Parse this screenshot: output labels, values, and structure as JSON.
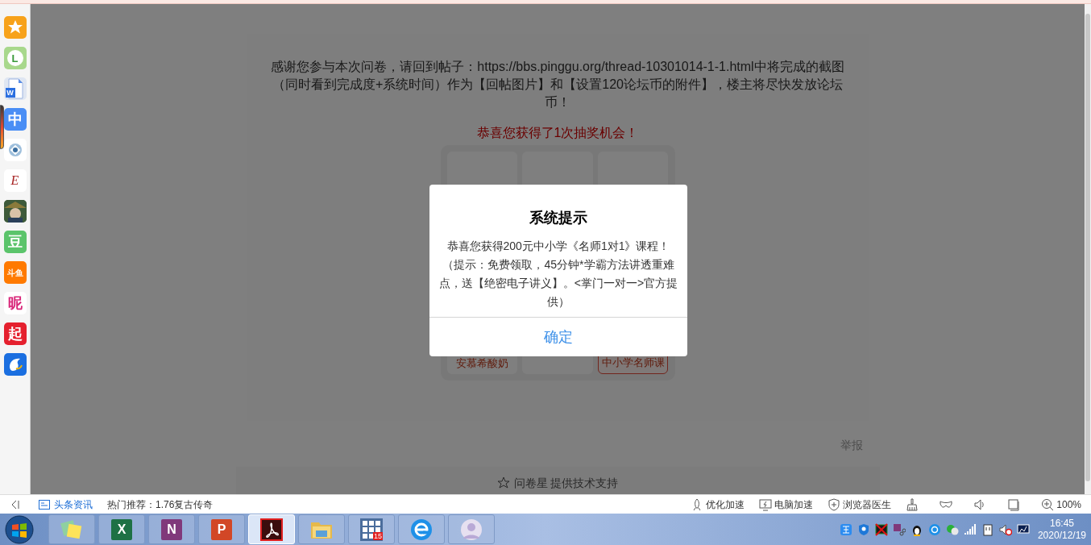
{
  "sidebar": {
    "apps": [
      {
        "kind": "star",
        "color": "#f7a21b"
      },
      {
        "kind": "clock",
        "color": "#a8d88c",
        "glyph": "L"
      },
      {
        "kind": "document",
        "color": "#dfe6f2",
        "glyph": "W"
      },
      {
        "kind": "text",
        "color": "#4a8ef5",
        "glyph": "中"
      },
      {
        "kind": "target",
        "color": "#ffffff"
      },
      {
        "kind": "serif",
        "color": "#ffffff",
        "glyph": "E"
      },
      {
        "kind": "picture",
        "color": "#3d5a3a"
      },
      {
        "kind": "text",
        "color": "#5bc46b",
        "glyph": "豆"
      },
      {
        "kind": "text",
        "color": "#ff7a00",
        "glyph": "斗鱼"
      },
      {
        "kind": "pinktext",
        "color": "#ffffff",
        "glyph": "昵"
      },
      {
        "kind": "text",
        "color": "#e5202e",
        "glyph": "起"
      },
      {
        "kind": "dolphin",
        "color": "#1b6fe0"
      }
    ]
  },
  "survey": {
    "message": "感谢您参与本次问卷，请回到帖子：https://bbs.pinggu.org/thread-10301014-1-1.html中将完成的截图（同时看到完成度+系统时间）作为【回帖图片】和【设置120论坛币的附件】，楼主将尽快发放论坛币！",
    "prize_notice": "恭喜您获得了1次抽奖机会！",
    "prizes": [
      {
        "label": "安慕希酸奶",
        "selected": false
      },
      {
        "selected": false
      },
      {
        "label": "中小学名师课",
        "selected": true
      }
    ],
    "report": "举报",
    "footer": "问卷星 提供技术支持"
  },
  "dialog": {
    "title": "系统提示",
    "message": "恭喜您获得200元中小学《名师1对1》课程！（提示：免费领取，45分钟*学霸方法讲透重难点，送【绝密电子讲义】。<掌门一对一>官方提供）",
    "button": "确定"
  },
  "status_bar": {
    "news": "头条资讯",
    "hot": "热门推荐：1.76复古传奇",
    "tools": [
      {
        "kind": "rocket",
        "label": "优化加速"
      },
      {
        "kind": "monitor",
        "label": "电脑加速"
      },
      {
        "kind": "shield",
        "label": "浏览器医生"
      },
      {
        "kind": "broom"
      },
      {
        "kind": "mask"
      },
      {
        "kind": "speaker"
      },
      {
        "kind": "window"
      }
    ],
    "zoom": "100%"
  },
  "taskbar": {
    "apps": [
      {
        "kind": "notes",
        "selected": false
      },
      {
        "kind": "letter",
        "glyph": "X",
        "color": "#1e7145",
        "selected": false
      },
      {
        "kind": "letter",
        "glyph": "N",
        "color": "#80397b",
        "selected": false
      },
      {
        "kind": "letter",
        "glyph": "P",
        "color": "#d24726",
        "selected": false
      },
      {
        "kind": "acrobat",
        "selected": true
      },
      {
        "kind": "folder",
        "selected": false
      },
      {
        "kind": "grid",
        "badge": "15",
        "selected": false
      },
      {
        "kind": "ie",
        "selected": false
      },
      {
        "kind": "avatar",
        "selected": false
      }
    ],
    "tray": [
      {
        "kind": "ime"
      },
      {
        "kind": "shield"
      },
      {
        "kind": "monitor-off"
      },
      {
        "kind": "clip"
      },
      {
        "kind": "penguin"
      },
      {
        "kind": "ie"
      },
      {
        "kind": "chat"
      },
      {
        "kind": "signal"
      },
      {
        "kind": "power"
      },
      {
        "kind": "mute"
      },
      {
        "kind": "display"
      }
    ],
    "time": "16:45",
    "date": "2020/12/19"
  }
}
